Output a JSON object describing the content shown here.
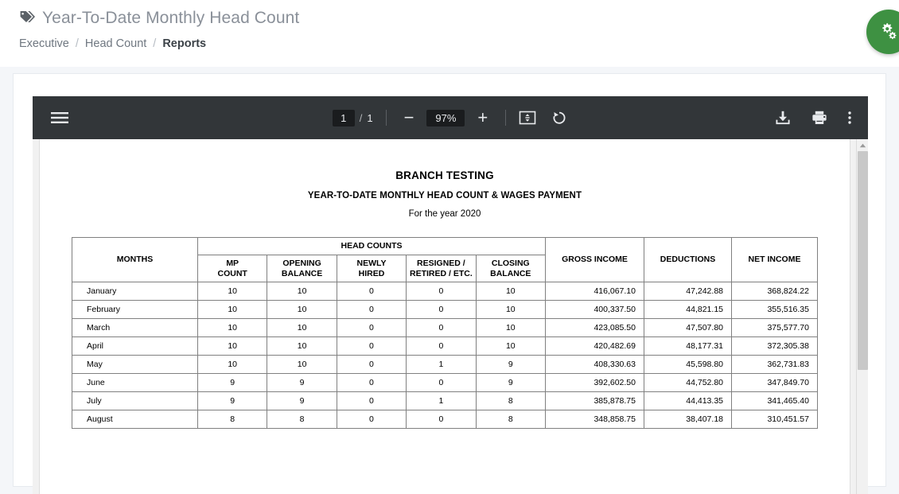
{
  "header": {
    "tag_icon": "tag-icon",
    "title": "Year-To-Date Monthly Head Count",
    "breadcrumb": {
      "items": [
        {
          "label": "Executive",
          "current": false
        },
        {
          "label": "Head Count",
          "current": false
        },
        {
          "label": "Reports",
          "current": true
        }
      ],
      "separator": "/"
    }
  },
  "settings_fab": {
    "icon": "gears-icon",
    "color": "#3e9142"
  },
  "pdf_toolbar": {
    "menu_icon": "hamburger-menu-icon",
    "page_current": "1",
    "page_separator": "/",
    "page_total": "1",
    "zoom_out_label": "−",
    "zoom_level": "97%",
    "zoom_in_label": "+",
    "fit_page_icon": "fit-to-page-icon",
    "rotate_icon": "rotate-counterclockwise-icon",
    "download_icon": "download-icon",
    "print_icon": "print-icon",
    "more_icon": "more-options-icon",
    "background": "#323639"
  },
  "document": {
    "company": "BRANCH TESTING",
    "subtitle": "YEAR-TO-DATE MONTHLY HEAD COUNT & WAGES PAYMENT",
    "year_line": "For the year 2020",
    "table": {
      "group_header": "HEAD COUNTS",
      "columns": [
        "MONTHS",
        "MP COUNT",
        "OPENING BALANCE",
        "NEWLY HIRED",
        "RESIGNED / RETIRED /  ETC.",
        "CLOSING BALANCE",
        "GROSS INCOME",
        "DEDUCTIONS",
        "NET INCOME"
      ],
      "columns_split": {
        "months": "MONTHS",
        "mp_count": [
          "MP",
          "COUNT"
        ],
        "opening_balance": [
          "OPENING",
          "BALANCE"
        ],
        "newly_hired": [
          "NEWLY",
          "HIRED"
        ],
        "resigned": [
          "RESIGNED /",
          "RETIRED /  ETC."
        ],
        "closing_balance": [
          "CLOSING",
          "BALANCE"
        ],
        "gross_income": "GROSS INCOME",
        "deductions": "DEDUCTIONS",
        "net_income": "NET INCOME"
      },
      "rows": [
        {
          "month": "January",
          "mp_count": "10",
          "opening": "10",
          "newly_hired": "0",
          "resigned": "0",
          "closing": "10",
          "gross": "416,067.10",
          "deductions": "47,242.88",
          "net": "368,824.22"
        },
        {
          "month": "February",
          "mp_count": "10",
          "opening": "10",
          "newly_hired": "0",
          "resigned": "0",
          "closing": "10",
          "gross": "400,337.50",
          "deductions": "44,821.15",
          "net": "355,516.35"
        },
        {
          "month": "March",
          "mp_count": "10",
          "opening": "10",
          "newly_hired": "0",
          "resigned": "0",
          "closing": "10",
          "gross": "423,085.50",
          "deductions": "47,507.80",
          "net": "375,577.70"
        },
        {
          "month": "April",
          "mp_count": "10",
          "opening": "10",
          "newly_hired": "0",
          "resigned": "0",
          "closing": "10",
          "gross": "420,482.69",
          "deductions": "48,177.31",
          "net": "372,305.38"
        },
        {
          "month": "May",
          "mp_count": "10",
          "opening": "10",
          "newly_hired": "0",
          "resigned": "1",
          "closing": "9",
          "gross": "408,330.63",
          "deductions": "45,598.80",
          "net": "362,731.83"
        },
        {
          "month": "June",
          "mp_count": "9",
          "opening": "9",
          "newly_hired": "0",
          "resigned": "0",
          "closing": "9",
          "gross": "392,602.50",
          "deductions": "44,752.80",
          "net": "347,849.70"
        },
        {
          "month": "July",
          "mp_count": "9",
          "opening": "9",
          "newly_hired": "0",
          "resigned": "1",
          "closing": "8",
          "gross": "385,878.75",
          "deductions": "44,413.35",
          "net": "341,465.40"
        },
        {
          "month": "August",
          "mp_count": "8",
          "opening": "8",
          "newly_hired": "0",
          "resigned": "0",
          "closing": "8",
          "gross": "348,858.75",
          "deductions": "38,407.18",
          "net": "310,451.57"
        }
      ]
    }
  },
  "scrollbar": {
    "up_arrow_icon": "chevron-up-icon"
  }
}
